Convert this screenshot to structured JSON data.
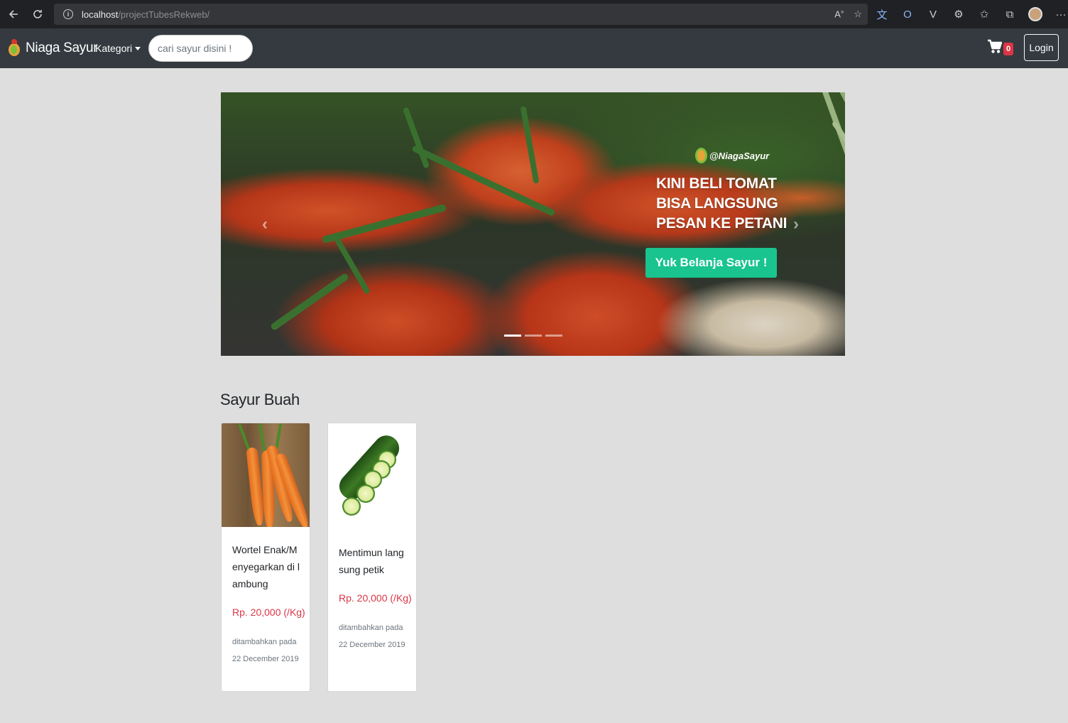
{
  "browser": {
    "url_host": "localhost",
    "url_path": "/projectTubesRekweb/"
  },
  "navbar": {
    "brand": "Niaga Sayur",
    "kategori_label": "Kategori",
    "search_placeholder": "cari sayur disini !",
    "cart_count": "0",
    "login_label": "Login"
  },
  "carousel": {
    "brand_handle": "@NiagaSayur",
    "headline_line1": "KINI BELI TOMAT",
    "headline_line2": "BISA LANGSUNG",
    "headline_line3": "PESAN KE PETANI",
    "cta_label": "Yuk Belanja Sayur !",
    "prev_icon": "chevron-left-icon",
    "next_icon": "chevron-right-icon",
    "slide_count": 3,
    "active_slide": 1
  },
  "section": {
    "title": "Sayur Buah"
  },
  "products": [
    {
      "title": "Wortel Enak/Menyegarkan di lambung",
      "price": "Rp. 20,000 (/Kg)",
      "date": "ditambahkan pada 22 December 2019"
    },
    {
      "title": "Mentimun langsung petik",
      "price": "Rp. 20,000 (/Kg)",
      "date": "ditambahkan pada 22 December 2019"
    }
  ],
  "colors": {
    "navbar_bg": "#343a40",
    "page_bg": "#dedede",
    "cta_green": "#19c48e",
    "price_red": "#dc3545",
    "badge_red": "#dc3545"
  }
}
